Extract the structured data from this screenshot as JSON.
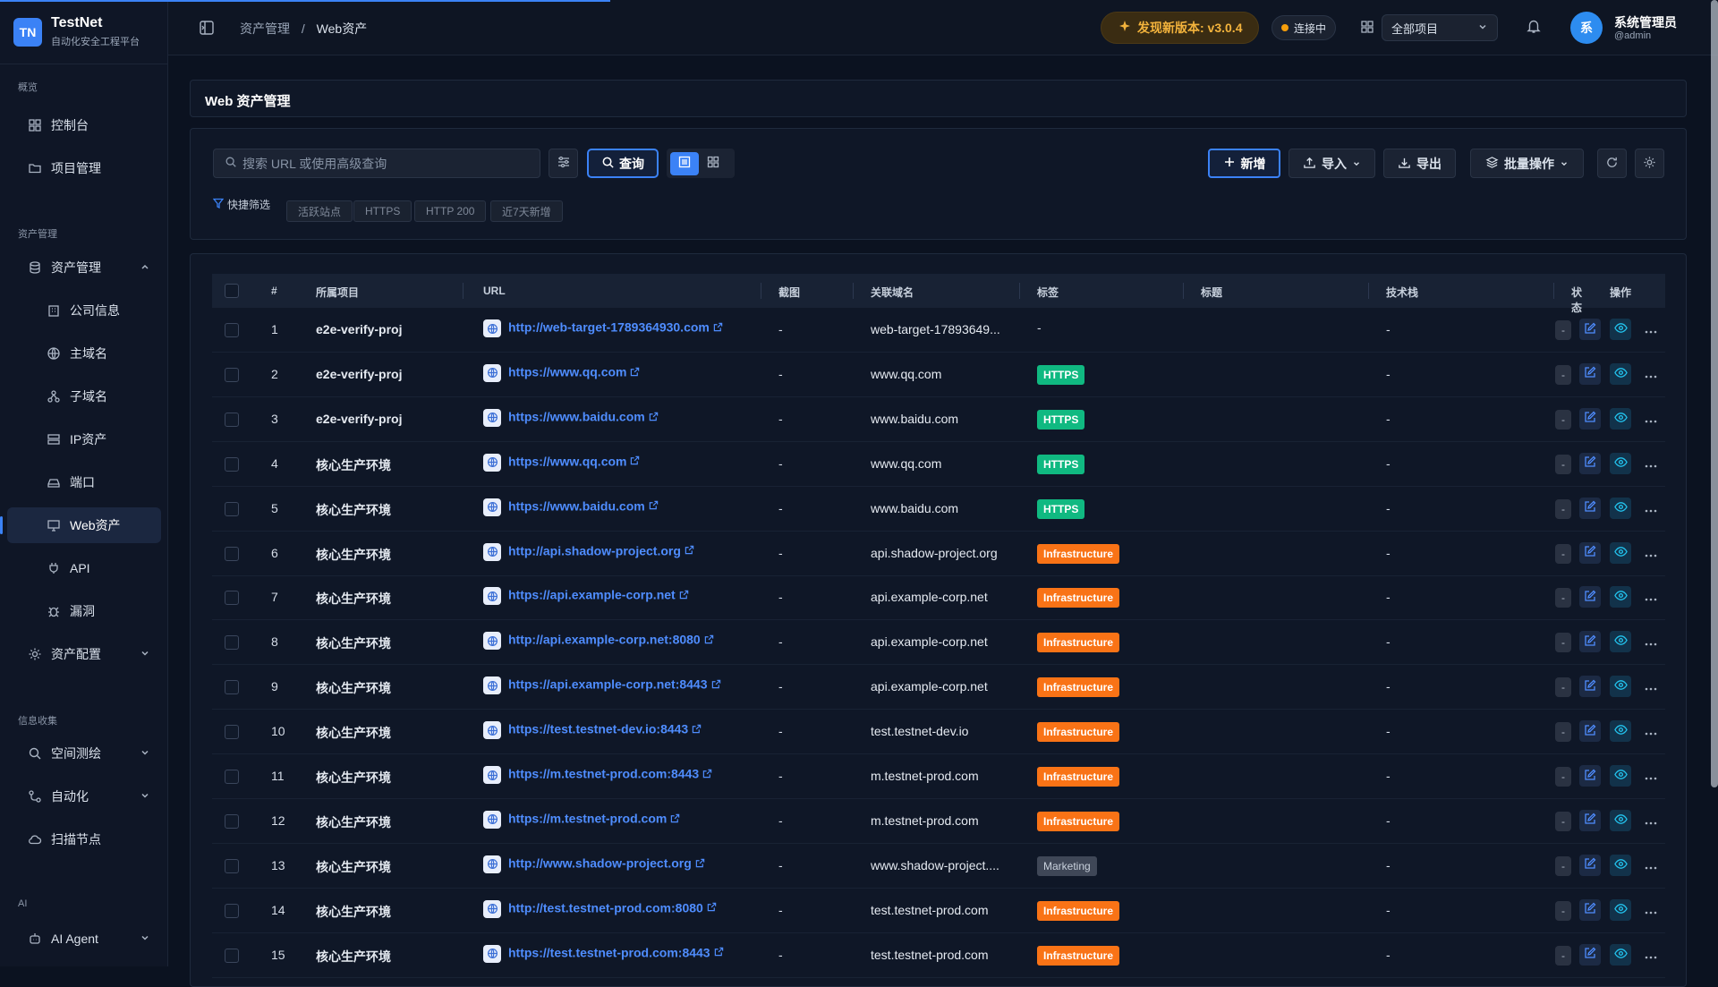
{
  "app": {
    "logo": "TN",
    "name": "TestNet",
    "subtitle": "自动化安全工程平台"
  },
  "sidebar": {
    "sections": [
      {
        "label": "概览"
      },
      {
        "label": "资产管理"
      },
      {
        "label": "信息收集"
      },
      {
        "label": "AI"
      }
    ],
    "items": [
      {
        "label": "控制台",
        "icon": "dashboard-icon"
      },
      {
        "label": "项目管理",
        "icon": "folder-icon"
      },
      {
        "label": "资产管理",
        "icon": "database-icon"
      },
      {
        "label": "公司信息",
        "icon": "building-icon"
      },
      {
        "label": "主域名",
        "icon": "globe-icon"
      },
      {
        "label": "子域名",
        "icon": "sitemap-icon"
      },
      {
        "label": "IP资产",
        "icon": "server-icon"
      },
      {
        "label": "端口",
        "icon": "port-icon"
      },
      {
        "label": "Web资产",
        "icon": "monitor-icon"
      },
      {
        "label": "API",
        "icon": "plug-icon"
      },
      {
        "label": "漏洞",
        "icon": "bug-icon"
      },
      {
        "label": "资产配置",
        "icon": "gear-icon"
      },
      {
        "label": "空间测绘",
        "icon": "search-icon"
      },
      {
        "label": "自动化",
        "icon": "workflow-icon"
      },
      {
        "label": "扫描节点",
        "icon": "cloud-icon"
      },
      {
        "label": "AI Agent",
        "icon": "robot-icon"
      }
    ]
  },
  "header": {
    "breadcrumb": [
      "资产管理",
      "/",
      "Web资产"
    ],
    "version_label": "发现新版本: v3.0.4",
    "connection": "连接中",
    "project_select": "全部项目",
    "user_avatar": "系",
    "user_name": "系统管理员",
    "user_id": "@admin"
  },
  "page": {
    "title": "Web 资产管理"
  },
  "toolbar": {
    "search_placeholder": "搜索 URL 或使用高级查询",
    "query_label": "查询",
    "quick_filter_label": "快捷筛选",
    "chips": [
      "活跃站点",
      "HTTPS",
      "HTTP 200",
      "近7天新增"
    ],
    "add_label": "新增",
    "import_label": "导入",
    "export_label": "导出",
    "batch_label": "批量操作"
  },
  "table": {
    "columns": [
      "#",
      "所属项目",
      "URL",
      "截图",
      "关联域名",
      "标签",
      "标题",
      "技术栈",
      "状态",
      "操作"
    ],
    "rows": [
      {
        "n": "1",
        "project": "e2e-verify-proj",
        "url": "http://web-target-1789364930.com",
        "shot": "-",
        "domain": "web-target-17893649...",
        "tag": "-",
        "tag_type": "none",
        "title": "",
        "tech": "-"
      },
      {
        "n": "2",
        "project": "e2e-verify-proj",
        "url": "https://www.qq.com",
        "shot": "-",
        "domain": "www.qq.com",
        "tag": "HTTPS",
        "tag_type": "https",
        "title": "",
        "tech": "-"
      },
      {
        "n": "3",
        "project": "e2e-verify-proj",
        "url": "https://www.baidu.com",
        "shot": "-",
        "domain": "www.baidu.com",
        "tag": "HTTPS",
        "tag_type": "https",
        "title": "",
        "tech": "-"
      },
      {
        "n": "4",
        "project": "核心生产环境",
        "url": "https://www.qq.com",
        "shot": "-",
        "domain": "www.qq.com",
        "tag": "HTTPS",
        "tag_type": "https",
        "title": "",
        "tech": "-"
      },
      {
        "n": "5",
        "project": "核心生产环境",
        "url": "https://www.baidu.com",
        "shot": "-",
        "domain": "www.baidu.com",
        "tag": "HTTPS",
        "tag_type": "https",
        "title": "",
        "tech": "-"
      },
      {
        "n": "6",
        "project": "核心生产环境",
        "url": "http://api.shadow-project.org",
        "shot": "-",
        "domain": "api.shadow-project.org",
        "tag": "Infrastructure",
        "tag_type": "infra",
        "title": "",
        "tech": "-"
      },
      {
        "n": "7",
        "project": "核心生产环境",
        "url": "https://api.example-corp.net",
        "shot": "-",
        "domain": "api.example-corp.net",
        "tag": "Infrastructure",
        "tag_type": "infra",
        "title": "",
        "tech": "-"
      },
      {
        "n": "8",
        "project": "核心生产环境",
        "url": "http://api.example-corp.net:8080",
        "shot": "-",
        "domain": "api.example-corp.net",
        "tag": "Infrastructure",
        "tag_type": "infra",
        "title": "",
        "tech": "-"
      },
      {
        "n": "9",
        "project": "核心生产环境",
        "url": "https://api.example-corp.net:8443",
        "shot": "-",
        "domain": "api.example-corp.net",
        "tag": "Infrastructure",
        "tag_type": "infra",
        "title": "",
        "tech": "-"
      },
      {
        "n": "10",
        "project": "核心生产环境",
        "url": "https://test.testnet-dev.io:8443",
        "shot": "-",
        "domain": "test.testnet-dev.io",
        "tag": "Infrastructure",
        "tag_type": "infra",
        "title": "",
        "tech": "-"
      },
      {
        "n": "11",
        "project": "核心生产环境",
        "url": "https://m.testnet-prod.com:8443",
        "shot": "-",
        "domain": "m.testnet-prod.com",
        "tag": "Infrastructure",
        "tag_type": "infra",
        "title": "",
        "tech": "-"
      },
      {
        "n": "12",
        "project": "核心生产环境",
        "url": "https://m.testnet-prod.com",
        "shot": "-",
        "domain": "m.testnet-prod.com",
        "tag": "Infrastructure",
        "tag_type": "infra",
        "title": "",
        "tech": "-"
      },
      {
        "n": "13",
        "project": "核心生产环境",
        "url": "http://www.shadow-project.org",
        "shot": "-",
        "domain": "www.shadow-project....",
        "tag": "Marketing",
        "tag_type": "marketing",
        "title": "",
        "tech": "-"
      },
      {
        "n": "14",
        "project": "核心生产环境",
        "url": "http://test.testnet-prod.com:8080",
        "shot": "-",
        "domain": "test.testnet-prod.com",
        "tag": "Infrastructure",
        "tag_type": "infra",
        "title": "",
        "tech": "-"
      },
      {
        "n": "15",
        "project": "核心生产环境",
        "url": "https://test.testnet-prod.com:8443",
        "shot": "-",
        "domain": "test.testnet-prod.com",
        "tag": "Infrastructure",
        "tag_type": "infra",
        "title": "",
        "tech": "-"
      }
    ],
    "status_placeholder": "-"
  },
  "colors": {
    "accent": "#3b82f6",
    "https": "#10b981",
    "infra": "#f97316",
    "marketing": "#3f4757",
    "version_text": "#f3b33c"
  }
}
